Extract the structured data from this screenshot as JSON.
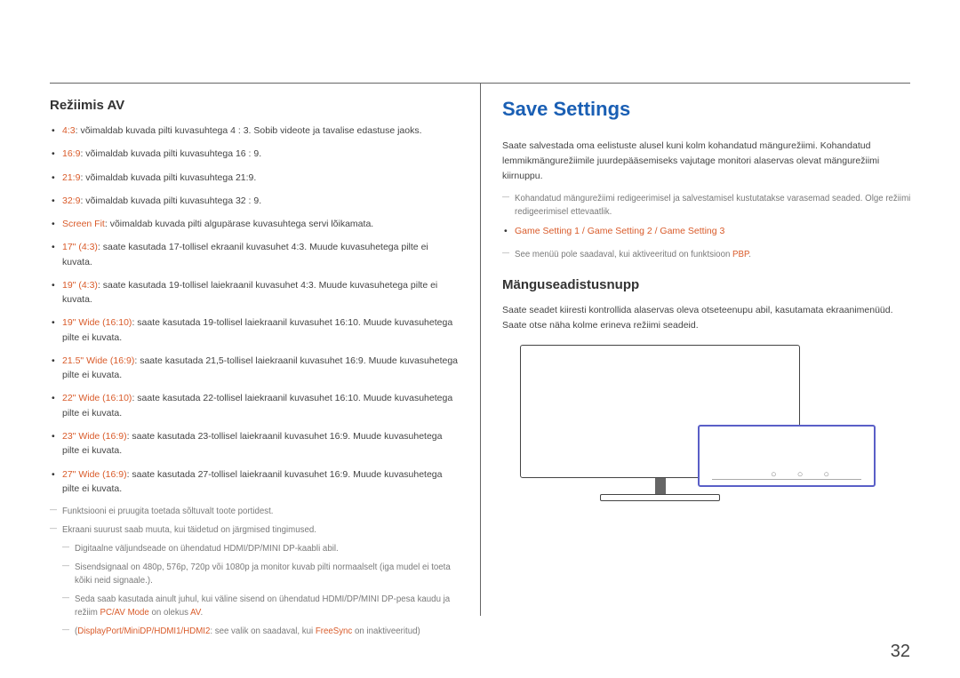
{
  "left": {
    "heading": "Režiimis AV",
    "bullets": [
      {
        "label": "4:3",
        "text": ": võimaldab kuvada pilti kuvasuhtega 4 : 3. Sobib videote ja tavalise edastuse jaoks."
      },
      {
        "label": "16:9",
        "text": ": võimaldab kuvada pilti kuvasuhtega 16 : 9."
      },
      {
        "label": "21:9",
        "text": ": võimaldab kuvada pilti kuvasuhtega 21:9."
      },
      {
        "label": "32:9",
        "text": ": võimaldab kuvada pilti kuvasuhtega 32 : 9."
      },
      {
        "label": "Screen Fit",
        "text": ": võimaldab kuvada pilti algupärase kuvasuhtega servi lõikamata."
      },
      {
        "label": "17\" (4:3)",
        "text": ": saate kasutada 17-tollisel ekraanil kuvasuhet 4:3. Muude kuvasuhetega pilte ei kuvata."
      },
      {
        "label": "19\" (4:3)",
        "text": ": saate kasutada 19-tollisel laiekraanil kuvasuhet 4:3. Muude kuvasuhetega pilte ei kuvata."
      },
      {
        "label": "19\" Wide (16:10)",
        "text": ": saate kasutada 19-tollisel laiekraanil kuvasuhet 16:10. Muude kuvasuhetega pilte ei kuvata."
      },
      {
        "label": "21.5\" Wide (16:9)",
        "text": ": saate kasutada 21,5-tollisel laiekraanil kuvasuhet 16:9. Muude kuvasuhetega pilte ei kuvata."
      },
      {
        "label": "22\" Wide (16:10)",
        "text": ": saate kasutada 22-tollisel laiekraanil kuvasuhet 16:10. Muude kuvasuhetega pilte ei kuvata."
      },
      {
        "label": "23\" Wide (16:9)",
        "text": ": saate kasutada 23-tollisel laiekraanil kuvasuhet 16:9. Muude kuvasuhetega pilte ei kuvata."
      },
      {
        "label": "27\" Wide (16:9)",
        "text": ": saate kasutada 27-tollisel laiekraanil kuvasuhet 16:9. Muude kuvasuhetega pilte ei kuvata."
      }
    ],
    "notes": {
      "n1": "Funktsiooni ei pruugita toetada sõltuvalt toote portidest.",
      "n2": "Ekraani suurust saab muuta, kui täidetud on järgmised tingimused.",
      "sub1": "Digitaalne väljundseade on ühendatud HDMI/DP/MINI DP-kaabli abil.",
      "sub2": "Sisendsignaal on 480p, 576p, 720p või 1080p ja monitor kuvab pilti normaalselt (iga mudel ei toeta kõiki neid signaale.).",
      "sub3_pre": "Seda saab kasutada ainult juhul, kui väline sisend on ühendatud HDMI/DP/MINI DP-pesa kaudu ja režiim ",
      "sub3_hl1": "PC/AV Mode",
      "sub3_mid": " on olekus ",
      "sub3_hl2": "AV",
      "sub3_post": ".",
      "sub4_pre": "(",
      "sub4_hl1": "DisplayPort/MiniDP/HDMI1/HDMI2",
      "sub4_mid": ": see valik on saadaval, kui ",
      "sub4_hl2": "FreeSync",
      "sub4_post": " on inaktiveeritud)"
    }
  },
  "right": {
    "mainHeading": "Save Settings",
    "para1": "Saate salvestada oma eelistuste alusel kuni kolm kohandatud mängurežiimi. Kohandatud lemmikmängurežiimile juurdepääsemiseks vajutage monitori alaservas olevat mängurežiimi kiirnuppu.",
    "note1": "Kohandatud mängurežiimi redigeerimisel ja salvestamisel kustutatakse varasemad seaded. Olge režiimi redigeerimisel ettevaatlik.",
    "bullet_hl": "Game Setting 1 / Game Setting 2 / Game Setting 3",
    "note2_pre": "See menüü pole saadaval, kui aktiveeritud on funktsioon ",
    "note2_hl": "PBP",
    "note2_post": ".",
    "subHeading": "Mänguseadistusnupp",
    "para2": "Saate seadet kiiresti kontrollida alaservas oleva otseteenupu abil, kasutamata ekraanimenüüd. Saate otse näha kolme erineva režiimi seadeid."
  },
  "pageNumber": "32"
}
